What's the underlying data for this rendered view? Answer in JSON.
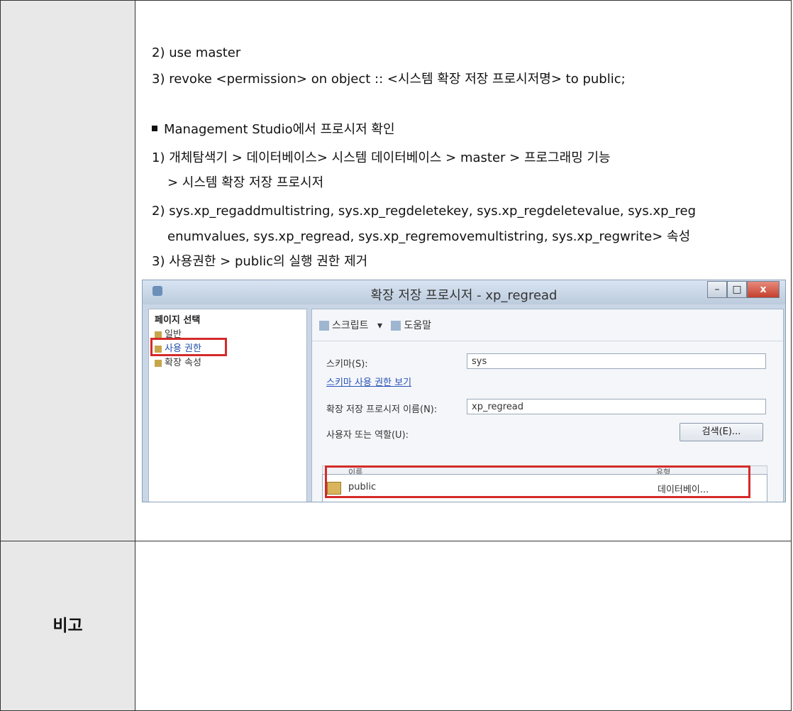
{
  "lines": {
    "l1": "2) use master",
    "l2": "3) revoke <permission> on object :: <시스템 확장 저장 프로시저명> to public;",
    "bullet": "Management Studio에서 프로시저 확인",
    "l3": "1) 개체탐색기 > 데이터베이스> 시스템 데이터베이스 > master > 프로그래밍 기능",
    "l3b": "> 시스템 확장 저장 프로시저",
    "l4": "2) sys.xp_regaddmultistring, sys.xp_regdeletekey, sys.xp_regdeletevalue, sys.xp_reg",
    "l4b": "enumvalues, sys.xp_regread, sys.xp_regremovemultistring, sys.xp_regwrite> 속성",
    "l5": "3) 사용권한 > public의 실행 권한 제거"
  },
  "remark_label": "비고",
  "dialog": {
    "title": "확장 저장 프로시저 - xp_regread",
    "win_min": "–",
    "win_max": "□",
    "win_close": "x",
    "left_header": "페이지 선택",
    "pages": [
      "일반",
      "사용 권한",
      "확장 속성"
    ],
    "toolbar_script": "스크립트",
    "toolbar_dropdown": "▾",
    "toolbar_help": "도움말",
    "schema_label": "스키마(S):",
    "schema_value": "sys",
    "schema_link": "스키마 사용 권한 보기",
    "name_label": "확장 저장 프로시저 이름(N):",
    "name_value": "xp_regread",
    "users_label": "사용자 또는 역할(U):",
    "search_button": "검색(E)...",
    "grid_col_name": "이름",
    "grid_col_type": "유형",
    "grid_row_name": "public",
    "grid_row_type": "데이터베이..."
  },
  "colors": {
    "highlight": "#d42a2a",
    "header_cell": "#e8e8e8"
  }
}
